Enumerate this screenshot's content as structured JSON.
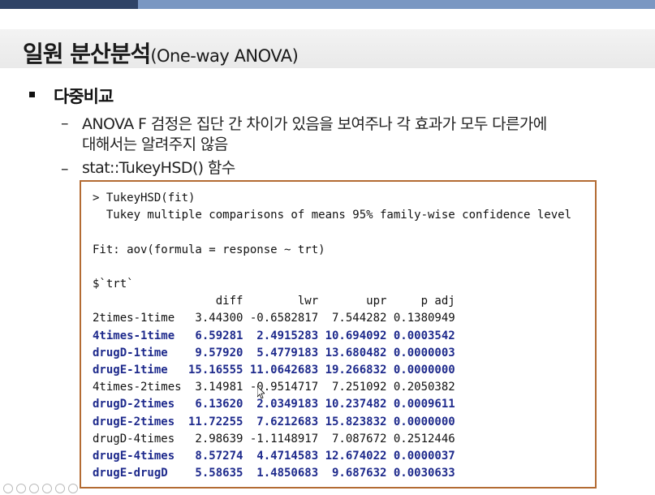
{
  "slide": {
    "title_main": "일원 분산분석",
    "title_sub": "(One-way ANOVA)",
    "bullet": "다중비교",
    "sub1_line1": "ANOVA  F 검정은  집단 간 차이가 있음을 보여주나 각 효과가 모두 다른가에",
    "sub1_line2": "대해서는 알려주지 않음",
    "sub2": "stat::TukeyHSD() 함수",
    "dash": "–"
  },
  "code": {
    "lines": [
      {
        "text": "> TukeyHSD(fit)",
        "highlight": false
      },
      {
        "text": "  Tukey multiple comparisons of means 95% family-wise confidence level",
        "highlight": false
      },
      {
        "text": "",
        "highlight": false
      },
      {
        "text": "Fit: aov(formula = response ~ trt)",
        "highlight": false
      },
      {
        "text": "",
        "highlight": false
      },
      {
        "text": "$`trt`",
        "highlight": false
      },
      {
        "text": "                  diff        lwr       upr     p adj",
        "highlight": false
      },
      {
        "text": "2times-1time   3.44300 -0.6582817  7.544282 0.1380949",
        "highlight": false
      },
      {
        "text": "4times-1time   6.59281  2.4915283 10.694092 0.0003542",
        "highlight": true
      },
      {
        "text": "drugD-1time    9.57920  5.4779183 13.680482 0.0000003",
        "highlight": true
      },
      {
        "text": "drugE-1time   15.16555 11.0642683 19.266832 0.0000000",
        "highlight": true
      },
      {
        "text": "4times-2times  3.14981 -0.9514717  7.251092 0.2050382",
        "highlight": false
      },
      {
        "text": "drugD-2times   6.13620  2.0349183 10.237482 0.0009611",
        "highlight": true
      },
      {
        "text": "drugE-2times  11.72255  7.6212683 15.823832 0.0000000",
        "highlight": true
      },
      {
        "text": "drugD-4times   2.98639 -1.1148917  7.087672 0.2512446",
        "highlight": false
      },
      {
        "text": "drugE-4times   8.57274  4.4714583 12.674022 0.0000037",
        "highlight": true
      },
      {
        "text": "drugE-drugD    5.58635  1.4850683  9.687632 0.0030633",
        "highlight": true
      }
    ]
  },
  "colors": {
    "highlight_text": "#1e2a8c",
    "box_border": "#b36b33",
    "top_bar_light": "#7a97c2",
    "top_bar_dark": "#2f4366"
  },
  "icons": [
    "pointer-cursor-icon",
    "slideshow-controls-icons"
  ]
}
